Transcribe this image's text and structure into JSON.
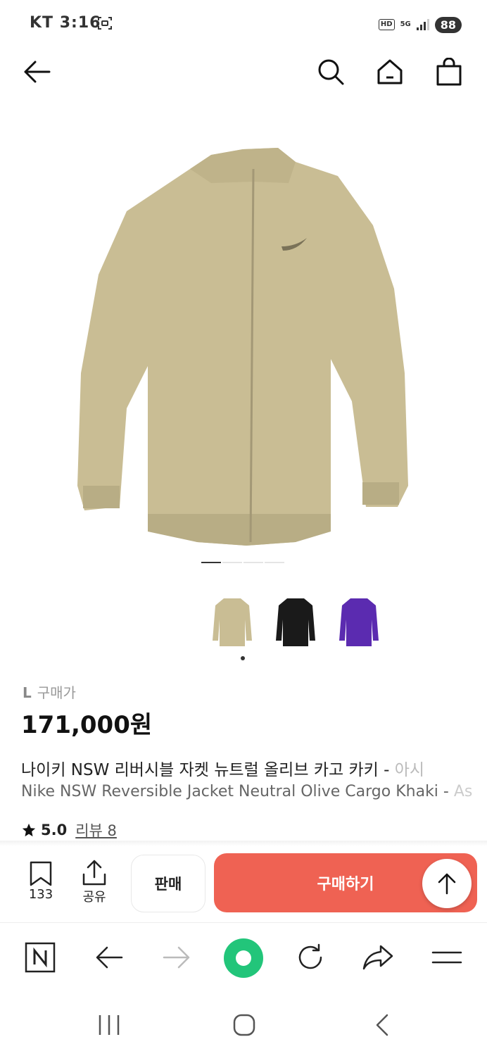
{
  "status_bar": {
    "carrier_time": "KT 3:16",
    "hd": "HD",
    "network": "5G",
    "battery": "88"
  },
  "product": {
    "size_label": "L",
    "price_type": "구매가",
    "price": "171,000원",
    "title_ko": "나이키 NSW 리버시블 자켓 뉴트럴 올리브 카고 카키 - ",
    "title_ko_fade": "아시",
    "title_en": "Nike NSW Reversible Jacket Neutral Olive Cargo Khaki - ",
    "title_en_fade": "As",
    "rating": "5.0",
    "review_label": "리뷰 8"
  },
  "actions": {
    "bookmark_count": "133",
    "share_label": "공유",
    "sell_label": "판매",
    "buy_label": "구매하기"
  },
  "colors": {
    "buy": "#ef6253",
    "browser_green": "#22c57a",
    "thumb_colors": [
      "#c9bd94",
      "#1a1a1a",
      "#5b2bb0"
    ]
  },
  "icons": [
    "back-arrow-icon",
    "search-icon",
    "home-icon",
    "shopping-bag-icon",
    "bookmark-icon",
    "share-icon",
    "arrow-up-icon",
    "naver-n-icon",
    "browser-back-icon",
    "browser-forward-icon",
    "browser-home-icon",
    "refresh-icon",
    "browser-share-icon",
    "menu-icon"
  ]
}
